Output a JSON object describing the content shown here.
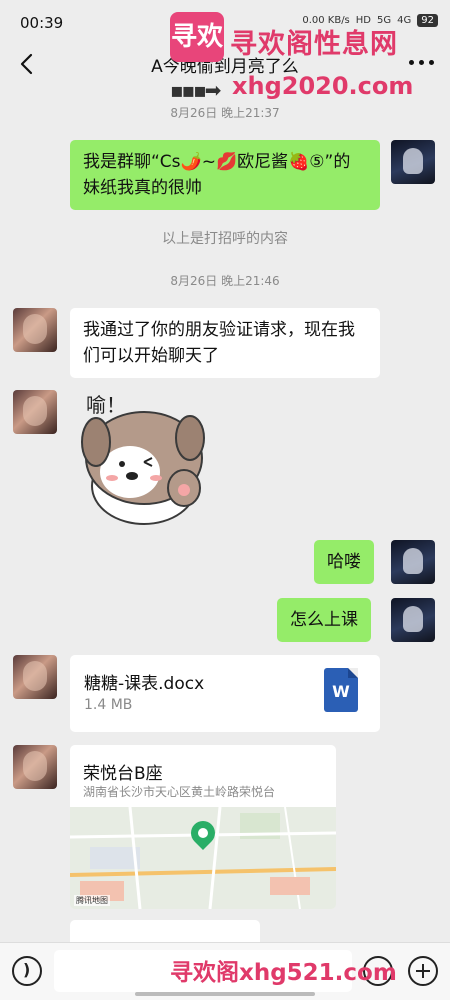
{
  "status_bar": {
    "time": "00:39",
    "network_speed": "0.00 KB/s",
    "hd": "HD",
    "signal_1": "5G",
    "signal_2": "4G",
    "battery": "92"
  },
  "header": {
    "title": "A今晚偷到月亮了么",
    "more_icon": "more-icon"
  },
  "watermark": {
    "logo_text": "寻欢",
    "title": "寻欢阁性息网",
    "url": "xhg2020.com",
    "bottom": "寻欢阁xhg521.com"
  },
  "messages": {
    "time_1": "8月26日 晚上21:37",
    "msg_1": "我是群聊“Cs🌶️~💋欧尼酱🍓⑤”的妹纸我真的很帅",
    "note_1": "以上是打招呼的内容",
    "time_2": "8月26日 晚上21:46",
    "msg_2": "我通过了你的朋友验证请求，现在我们可以开始聊天了",
    "sticker_text": "喻！",
    "msg_3": "哈喽",
    "msg_4": "怎么上课",
    "file": {
      "name": "糖糖-课表.docx",
      "size": "1.4 MB",
      "icon_letter": "W"
    },
    "location": {
      "name": "荣悦台B座",
      "address": "湖南省长沙市天心区黄土岭路荣悦台",
      "map_label": "腾讯地图"
    }
  },
  "colors": {
    "sent_bubble": "#95ec69",
    "received_bubble": "#ffffff",
    "background": "#ededed",
    "watermark": "#e03a6a"
  }
}
